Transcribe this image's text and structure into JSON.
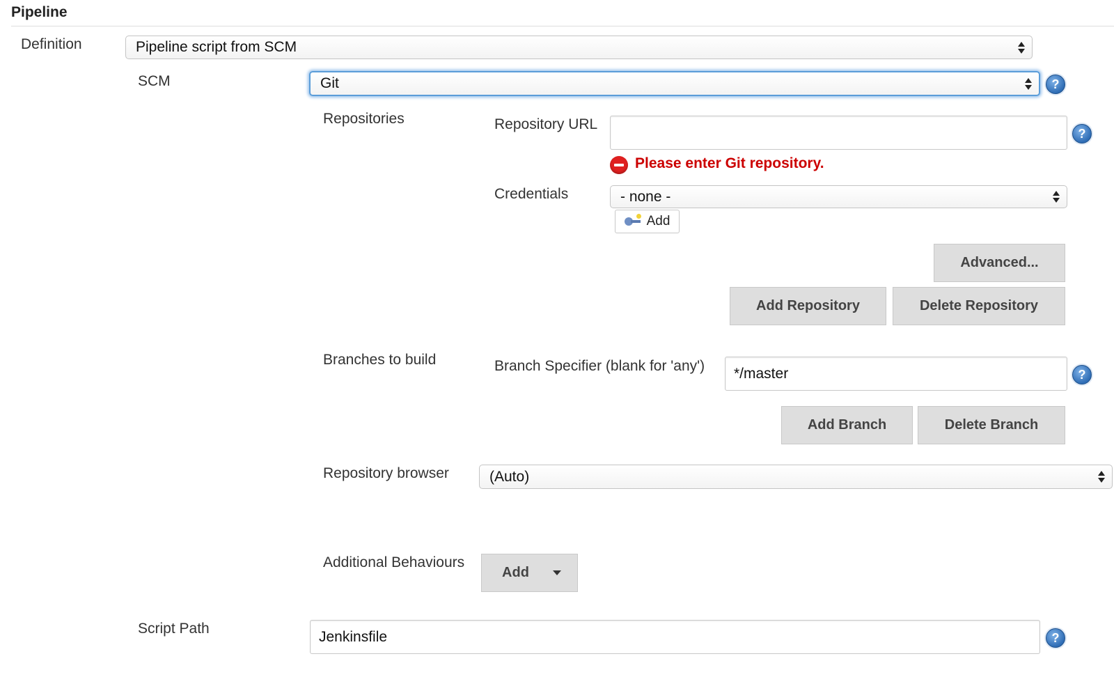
{
  "section": {
    "title": "Pipeline"
  },
  "definition": {
    "label": "Definition",
    "value": "Pipeline script from SCM"
  },
  "scm": {
    "label": "SCM",
    "value": "Git"
  },
  "repositories": {
    "label": "Repositories",
    "repo_url": {
      "label": "Repository URL",
      "value": "",
      "error": "Please enter Git repository."
    },
    "credentials": {
      "label": "Credentials",
      "value": "- none -",
      "add_label": "Add"
    },
    "advanced_label": "Advanced...",
    "add_repository_label": "Add Repository",
    "delete_repository_label": "Delete Repository"
  },
  "branches": {
    "label": "Branches to build",
    "specifier_label": "Branch Specifier (blank for 'any')",
    "specifier_value": "*/master",
    "add_branch_label": "Add Branch",
    "delete_branch_label": "Delete Branch"
  },
  "repo_browser": {
    "label": "Repository browser",
    "value": "(Auto)"
  },
  "additional_behaviours": {
    "label": "Additional Behaviours",
    "add_label": "Add"
  },
  "script_path": {
    "label": "Script Path",
    "value": "Jenkinsfile"
  },
  "help_glyph": "?",
  "colors": {
    "error": "#cc0000",
    "focus": "#5b9dd9",
    "help": "#2f6db5",
    "button_bg": "#dedede"
  }
}
